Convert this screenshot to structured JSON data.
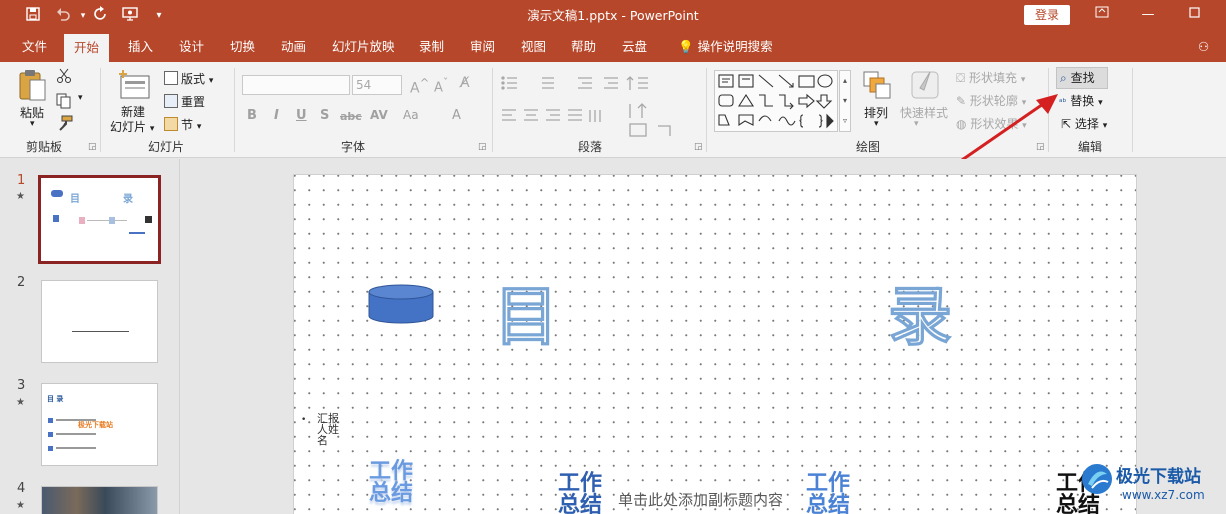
{
  "titlebar": {
    "doc_title": "演示文稿1.pptx  -  PowerPoint",
    "login": "登录",
    "colors": {
      "brand": "#b7472a"
    }
  },
  "menu": {
    "tabs": [
      "文件",
      "开始",
      "插入",
      "设计",
      "切换",
      "动画",
      "幻灯片放映",
      "录制",
      "审阅",
      "视图",
      "帮助",
      "云盘"
    ],
    "active": "开始",
    "tell_me": "操作说明搜索",
    "share": "共"
  },
  "ribbon": {
    "clipboard": {
      "paste": "粘贴",
      "group": "剪贴板"
    },
    "slides": {
      "new_slide": "新建\n幻灯片",
      "new_slide_l1": "新建",
      "new_slide_l2": "幻灯片",
      "layout": "版式",
      "reset": "重置",
      "section": "节",
      "group": "幻灯片"
    },
    "font": {
      "size": "54",
      "group": "字体",
      "buttons": [
        "B",
        "I",
        "U",
        "S",
        "abc",
        "AV",
        "Aa",
        "A"
      ]
    },
    "paragraph": {
      "group": "段落"
    },
    "drawing": {
      "arrange": "排列",
      "quick_styles": "快速样式",
      "shape_fill": "形状填充",
      "shape_outline": "形状轮廓",
      "shape_effects": "形状效果",
      "group": "绘图"
    },
    "editing": {
      "find": "查找",
      "replace": "替换",
      "select": "选择",
      "group": "编辑"
    }
  },
  "slides_panel": {
    "items": [
      {
        "num": "1",
        "star": "★"
      },
      {
        "num": "2",
        "star": ""
      },
      {
        "num": "3",
        "star": "★"
      },
      {
        "num": "4",
        "star": "★"
      }
    ],
    "thumb1": {
      "t1": "目",
      "t2": "录"
    },
    "thumb3": {
      "title": "目 录",
      "overlay": "极光下载站"
    }
  },
  "slide": {
    "char1": "目",
    "char2": "录",
    "vertical_small": "汇报人姓名",
    "wordart": [
      "工作",
      "总结"
    ],
    "subtitle_placeholder": "单击此处添加副标题内容"
  },
  "watermark": {
    "name": "极光下载站",
    "url": "www.xz7.com"
  }
}
